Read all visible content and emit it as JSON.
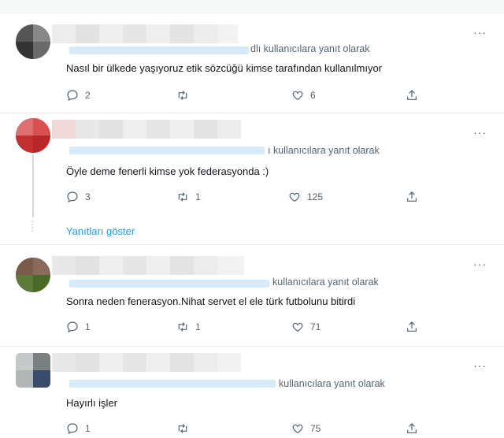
{
  "tweets": [
    {
      "reply_to": "dlı kullanıcılara yanıt olarak",
      "text": "Nasıl bir ülkede yaşıyoruz etik sözcüğü kimse tarafından kullanılmıyor",
      "replies": "2",
      "retweets": "",
      "likes": "6",
      "avatar_colors": [
        "#555",
        "#888",
        "#444",
        "#6a6a6a"
      ]
    },
    {
      "reply_to": "ı kullanıcılara yanıt olarak",
      "text": "Öyle deme fenerli kimse yok federasyonda :)",
      "replies": "3",
      "retweets": "1",
      "likes": "125",
      "avatar_colors": [
        "#d95050",
        "#c43030",
        "#e07070",
        "#b82828"
      ]
    },
    {
      "reply_to": "kullanıcılara yanıt olarak",
      "text": "Sonra neden fenerasyon.Nihat servet el ele türk futbolunu bitirdi",
      "replies": "1",
      "retweets": "1",
      "likes": "71",
      "avatar_colors": [
        "#7a5a4a",
        "#5d7a3a",
        "#8a6a5a",
        "#4a6a2a"
      ]
    },
    {
      "reply_to": "kullanıcılara yanıt olarak",
      "text": "Hayırlı işler",
      "replies": "1",
      "retweets": "",
      "likes": "75",
      "avatar_colors": [
        "#9aa0a0",
        "#7a8080",
        "#3a4a6a",
        "#b0b5b5"
      ]
    }
  ],
  "show_replies_label": "Yanıtları göster",
  "more_label": "···",
  "colors": {
    "link": "#1d9bf0",
    "muted": "#536471",
    "border": "#e6ecf0"
  }
}
